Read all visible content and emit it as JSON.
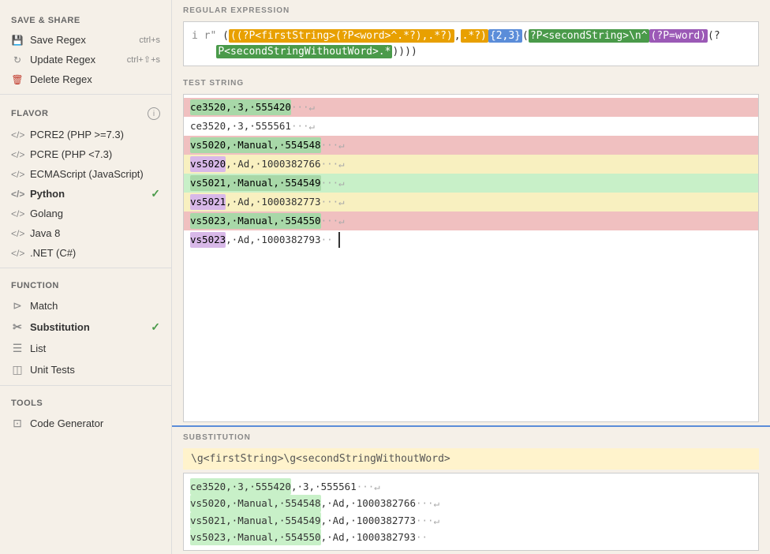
{
  "sidebar": {
    "save_share_label": "SAVE & SHARE",
    "items_save": [
      {
        "id": "save-regex",
        "icon": "💾",
        "label": "Save Regex",
        "shortcut": "ctrl+s"
      },
      {
        "id": "update-regex",
        "icon": "🔄",
        "label": "Update Regex",
        "shortcut": "ctrl+⇧+s"
      },
      {
        "id": "delete-regex",
        "icon": "🗑",
        "label": "Delete Regex",
        "shortcut": ""
      }
    ],
    "flavor_label": "FLAVOR",
    "flavors": [
      {
        "id": "pcre2",
        "label": "PCRE2 (PHP >=7.3)",
        "active": false
      },
      {
        "id": "pcre",
        "label": "PCRE (PHP <7.3)",
        "active": false
      },
      {
        "id": "ecma",
        "label": "ECMAScript (JavaScript)",
        "active": false
      },
      {
        "id": "python",
        "label": "Python",
        "active": true
      },
      {
        "id": "golang",
        "label": "Golang",
        "active": false
      },
      {
        "id": "java8",
        "label": "Java 8",
        "active": false
      },
      {
        "id": "dotnet",
        "label": ".NET (C#)",
        "active": false
      }
    ],
    "function_label": "FUNCTION",
    "functions": [
      {
        "id": "match",
        "label": "Match",
        "active": false
      },
      {
        "id": "substitution",
        "label": "Substitution",
        "active": true
      },
      {
        "id": "list",
        "label": "List",
        "active": false
      },
      {
        "id": "unit-tests",
        "label": "Unit Tests",
        "active": false
      }
    ],
    "tools_label": "TOOLS",
    "tools": [
      {
        "id": "code-generator",
        "label": "Code Generator"
      }
    ]
  },
  "main": {
    "regex_label": "REGULAR EXPRESSION",
    "regex_prefix": "i r\"",
    "test_string_label": "TEST STRING",
    "substitution_label": "SUBSTITUTION",
    "substitution_value": "\\g<firstString>\\g<secondStringWithoutWord>",
    "test_lines": [
      {
        "text": "ce3520,·3,·555420···↵",
        "style": "red"
      },
      {
        "text": "ce3520,·3,·555561···↵",
        "style": "normal"
      },
      {
        "text": "vs5020,·Manual,·554548···↵",
        "style": "red"
      },
      {
        "text": "vs5020,·Ad,·1000382766···↵",
        "style": "yellow"
      },
      {
        "text": "vs5021,·Manual,·554549···↵",
        "style": "green"
      },
      {
        "text": "vs5021,·Ad,·1000382773···↵",
        "style": "yellow"
      },
      {
        "text": "vs5023,·Manual,·554550···↵",
        "style": "red"
      },
      {
        "text": "vs5023,·Ad,·1000382793···↵",
        "style": "normal-cursor"
      }
    ],
    "sub_results": [
      "ce3520,·3,·555420,·3,·555561···↵",
      "vs5020,·Manual,·554548,·Ad,·1000382766···↵",
      "vs5021,·Manual,·554549,·Ad,·1000382773···↵",
      "vs5023,·Manual,·554550,·Ad,·1000382793··"
    ]
  }
}
